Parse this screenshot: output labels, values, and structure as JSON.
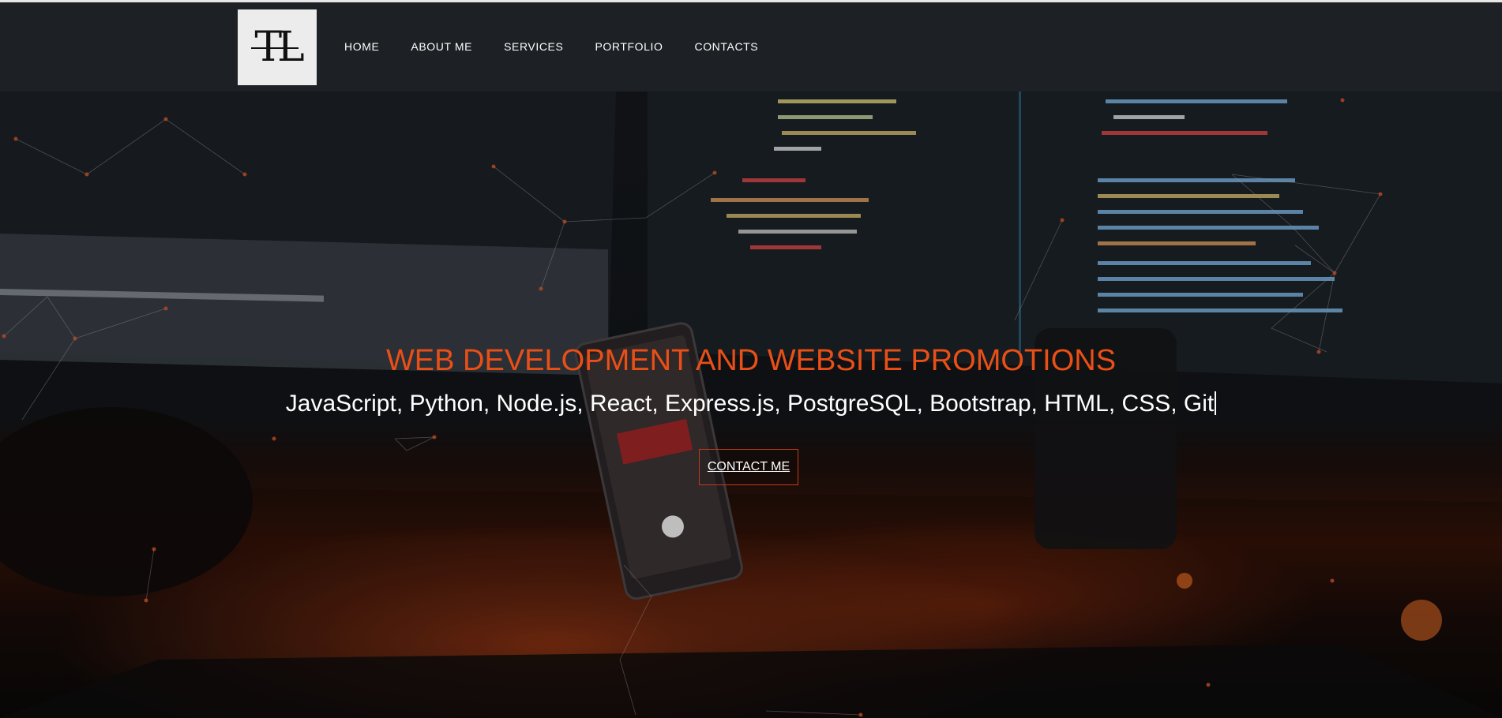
{
  "logo": {
    "text": "TL"
  },
  "nav": {
    "items": [
      {
        "label": "HOME"
      },
      {
        "label": "ABOUT ME"
      },
      {
        "label": "SERVICES"
      },
      {
        "label": "PORTFOLIO"
      },
      {
        "label": "CONTACTS"
      }
    ]
  },
  "hero": {
    "title": "WEB DEVELOPMENT AND WEBSITE PROMOTIONS",
    "subtitle": "JavaScript, Python, Node.js, React, Express.js, PostgreSQL, Bootstrap, HTML, CSS, Git",
    "cta_label": "CONTACT ME"
  },
  "colors": {
    "accent": "#ea4f16",
    "navbar_bg": "#1d2024",
    "text": "#ffffff"
  }
}
